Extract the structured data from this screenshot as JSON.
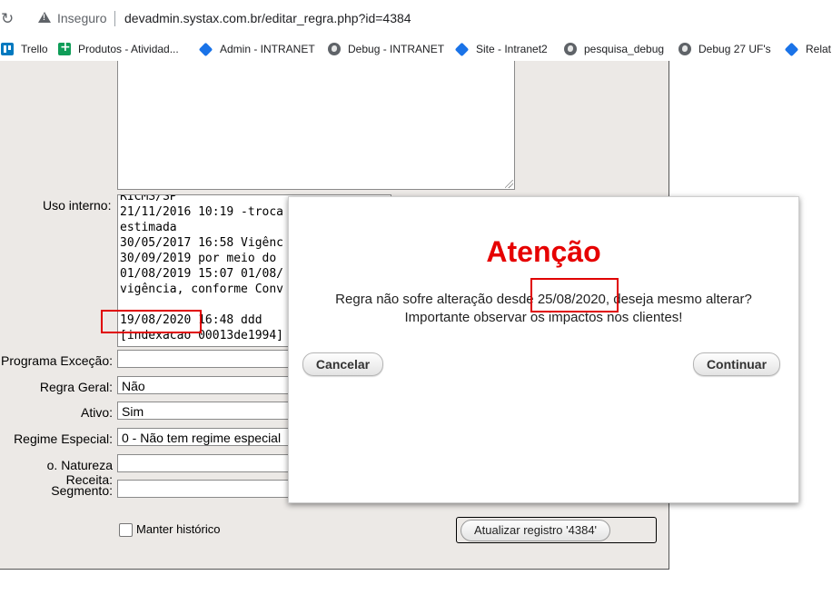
{
  "browser": {
    "security_label": "Inseguro",
    "url": "devadmin.systax.com.br/editar_regra.php?id=4384",
    "bookmarks": [
      {
        "label": "Trello",
        "icon": "trello-icon"
      },
      {
        "label": "Produtos - Atividad...",
        "icon": "sheets-icon"
      },
      {
        "label": "Admin - INTRANET",
        "icon": "diamond-icon"
      },
      {
        "label": "Debug - INTRANET",
        "icon": "globe-icon"
      },
      {
        "label": "Site - Intranet2",
        "icon": "diamond-icon"
      },
      {
        "label": "pesquisa_debug",
        "icon": "globe-icon"
      },
      {
        "label": "Debug 27 UF's",
        "icon": "globe-icon"
      },
      {
        "label": "Relat",
        "icon": "diamond-icon"
      }
    ]
  },
  "form": {
    "uso_interno_label": "Uso interno:",
    "uso_interno_text": "RICMS/SP\n21/11/2016 10:19 -troca\nestimada\n30/05/2017 16:58 Vigênc\n30/09/2019 por meio do\n01/08/2019 15:07 01/08/\nvigência, conforme Conv\n\n19/08/2020 16:48 ddd\n[indexacao 00013de1994]",
    "programa_excecao_label": "Programa Exceção:",
    "programa_excecao_value": "",
    "regra_geral_label": "Regra Geral:",
    "regra_geral_value": "Não",
    "ativo_label": "Ativo:",
    "ativo_value": "Sim",
    "regime_especial_label": "Regime Especial:",
    "regime_especial_value": "0 - Não tem regime especial",
    "natureza_receita_label": "o. Natureza Receita:",
    "natureza_receita_value": "",
    "segmento_label": "Segmento:",
    "segmento_value": "",
    "manter_historico_label": "Manter histórico",
    "manter_historico_checked": false,
    "update_button_label": "Atualizar registro '4384'"
  },
  "modal": {
    "title": "Atenção",
    "message_before": "Regra não sofre alteração desde ",
    "message_date": "25/08/2020",
    "message_after": ", deseja mesmo alterar?",
    "message_line2": "Importante observar os impactos nos clientes!",
    "cancel_label": "Cancelar",
    "continue_label": "Continuar"
  },
  "colors": {
    "panel_bg": "#ECE9E6",
    "title_red": "#e60000",
    "highlight_red": "#e00000"
  }
}
